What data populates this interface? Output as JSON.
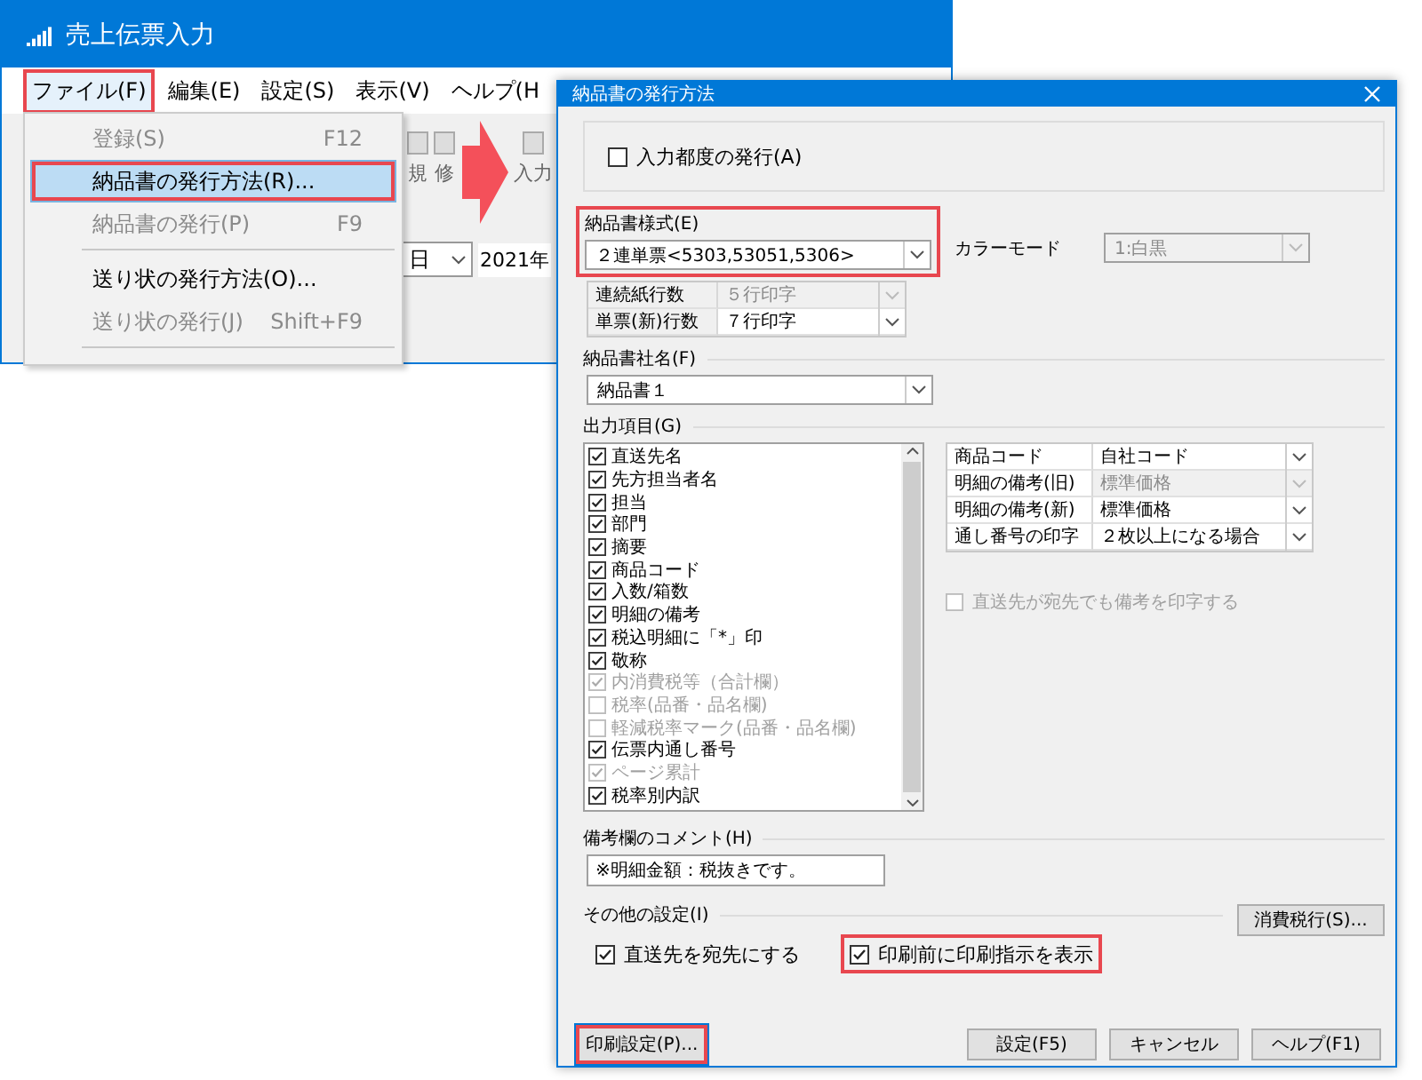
{
  "main_window": {
    "title": "売上伝票入力",
    "menu": [
      {
        "label": "ファイル(F)",
        "selected": true,
        "highlighted": true
      },
      {
        "label": "編集(E)",
        "selected": false,
        "highlighted": false
      },
      {
        "label": "設定(S)",
        "selected": false,
        "highlighted": false
      },
      {
        "label": "表示(V)",
        "selected": false,
        "highlighted": false
      },
      {
        "label": "ヘルプ(H",
        "selected": false,
        "highlighted": false
      }
    ],
    "file_menu": [
      {
        "label": "登録(S)",
        "shortcut": "F12",
        "disabled": true,
        "selected": false,
        "highlighted": false,
        "separator_after": false
      },
      {
        "label": "納品書の発行方法(R)...",
        "disabled": false,
        "selected": true,
        "highlighted": true,
        "separator_after": false
      },
      {
        "label": "納品書の発行(P)",
        "shortcut": "F9",
        "disabled": true,
        "selected": false,
        "highlighted": false,
        "separator_after": true
      },
      {
        "label": "送り状の発行方法(O)...",
        "disabled": false,
        "selected": false,
        "highlighted": false,
        "separator_after": false
      },
      {
        "label": "送り状の発行(J)",
        "shortcut": "Shift+F9",
        "disabled": true,
        "selected": false,
        "highlighted": false,
        "separator_after": true
      }
    ],
    "toolbar": [
      "規",
      "修",
      "入力"
    ],
    "date_field": {
      "value": "日"
    },
    "year_text": "2021年"
  },
  "dialog": {
    "title": "納品書の発行方法",
    "issue_each_time": {
      "label": "入力都度の発行(A)",
      "checked": false
    },
    "format": {
      "label": "納品書様式(E)",
      "value": "２連単票<5303,53051,5306>",
      "highlighted": true
    },
    "color_mode": {
      "label": "カラーモード",
      "value": "1:白黒",
      "disabled": true
    },
    "line_settings": [
      {
        "label": "連続紙行数",
        "value": "５行印字",
        "disabled": true
      },
      {
        "label": "単票(新)行数",
        "value": "７行印字",
        "disabled": false
      }
    ],
    "company_name": {
      "label": "納品書社名(F)",
      "value": "納品書１"
    },
    "output_items": {
      "label": "出力項目(G)",
      "items": [
        {
          "label": "直送先名",
          "checked": true,
          "disabled": false
        },
        {
          "label": "先方担当者名",
          "checked": true,
          "disabled": false
        },
        {
          "label": "担当",
          "checked": true,
          "disabled": false
        },
        {
          "label": "部門",
          "checked": true,
          "disabled": false
        },
        {
          "label": "摘要",
          "checked": true,
          "disabled": false
        },
        {
          "label": "商品コード",
          "checked": true,
          "disabled": false
        },
        {
          "label": "入数/箱数",
          "checked": true,
          "disabled": false
        },
        {
          "label": "明細の備考",
          "checked": true,
          "disabled": false
        },
        {
          "label": "税込明細に「*」印",
          "checked": true,
          "disabled": false
        },
        {
          "label": "敬称",
          "checked": true,
          "disabled": false
        },
        {
          "label": "内消費税等（合計欄）",
          "checked": true,
          "disabled": true
        },
        {
          "label": "税率(品番・品名欄)",
          "checked": false,
          "disabled": true
        },
        {
          "label": "軽減税率マーク(品番・品名欄)",
          "checked": false,
          "disabled": true
        },
        {
          "label": "伝票内通し番号",
          "checked": true,
          "disabled": false
        },
        {
          "label": "ページ累計",
          "checked": true,
          "disabled": true
        },
        {
          "label": "税率別内訳",
          "checked": true,
          "disabled": false
        }
      ]
    },
    "options": [
      {
        "label": "商品コード",
        "value": "自社コード",
        "disabled": false
      },
      {
        "label": "明細の備考(旧)",
        "value": "標準価格",
        "disabled": true
      },
      {
        "label": "明細の備考(新)",
        "value": "標準価格",
        "disabled": false
      },
      {
        "label": "通し番号の印字",
        "value": "２枚以上になる場合",
        "disabled": false
      }
    ],
    "print_remarks": {
      "label": "直送先が宛先でも備考を印字する",
      "checked": false,
      "disabled": true
    },
    "comment": {
      "label": "備考欄のコメント(H)",
      "value": "※明細金額：税抜きです。"
    },
    "other_settings": {
      "label": "その他の設定(I)",
      "checkboxes": [
        {
          "label": "直送先を宛先にする",
          "checked": true,
          "highlighted": false
        },
        {
          "label": "印刷前に印刷指示を表示",
          "checked": true,
          "highlighted": true
        }
      ]
    },
    "tax_button": "消費税行(S)...",
    "print_settings_button": {
      "label": "印刷設定(P)...",
      "highlighted": true
    },
    "buttons": [
      "設定(F5)",
      "キャンセル",
      "ヘルプ(F1)"
    ]
  }
}
